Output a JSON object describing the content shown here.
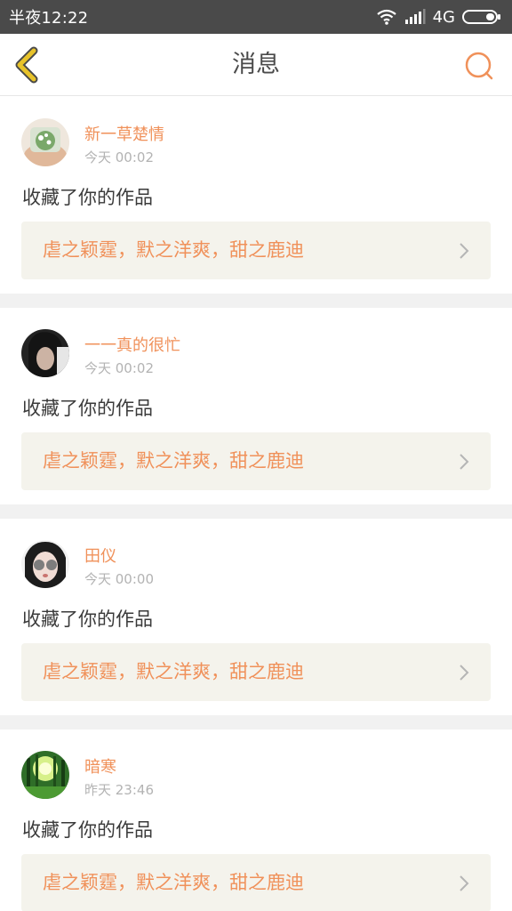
{
  "status_bar": {
    "time": "半夜12:22",
    "network": "4G",
    "icons": [
      "wifi-icon",
      "signal-icon",
      "battery-icon"
    ]
  },
  "header": {
    "title": "消息",
    "back_icon": "chevron-left-icon",
    "search_icon": "search-icon"
  },
  "colors": {
    "accent": "#f0915a",
    "back_arrow": "#e8c32a",
    "card_bg": "#f4f3ec",
    "status_bar": "#4a4a4a"
  },
  "messages": [
    {
      "username": "新一草楚情",
      "time": "今天 00:02",
      "action": "收藏了你的作品",
      "work_title": "虐之颖霆，默之洋爽，甜之鹿迪",
      "avatar": "avatar-plant"
    },
    {
      "username": "一一真的很忙",
      "time": "今天 00:02",
      "action": "收藏了你的作品",
      "work_title": "虐之颖霆，默之洋爽，甜之鹿迪",
      "avatar": "avatar-dark-hair"
    },
    {
      "username": "田仪",
      "time": "今天 00:00",
      "action": "收藏了你的作品",
      "work_title": "虐之颖霆，默之洋爽，甜之鹿迪",
      "avatar": "avatar-girl-sunglasses"
    },
    {
      "username": "暗寒",
      "time": "昨天 23:46",
      "action": "收藏了你的作品",
      "work_title": "虐之颖霆，默之洋爽，甜之鹿迪",
      "avatar": "avatar-forest"
    }
  ]
}
